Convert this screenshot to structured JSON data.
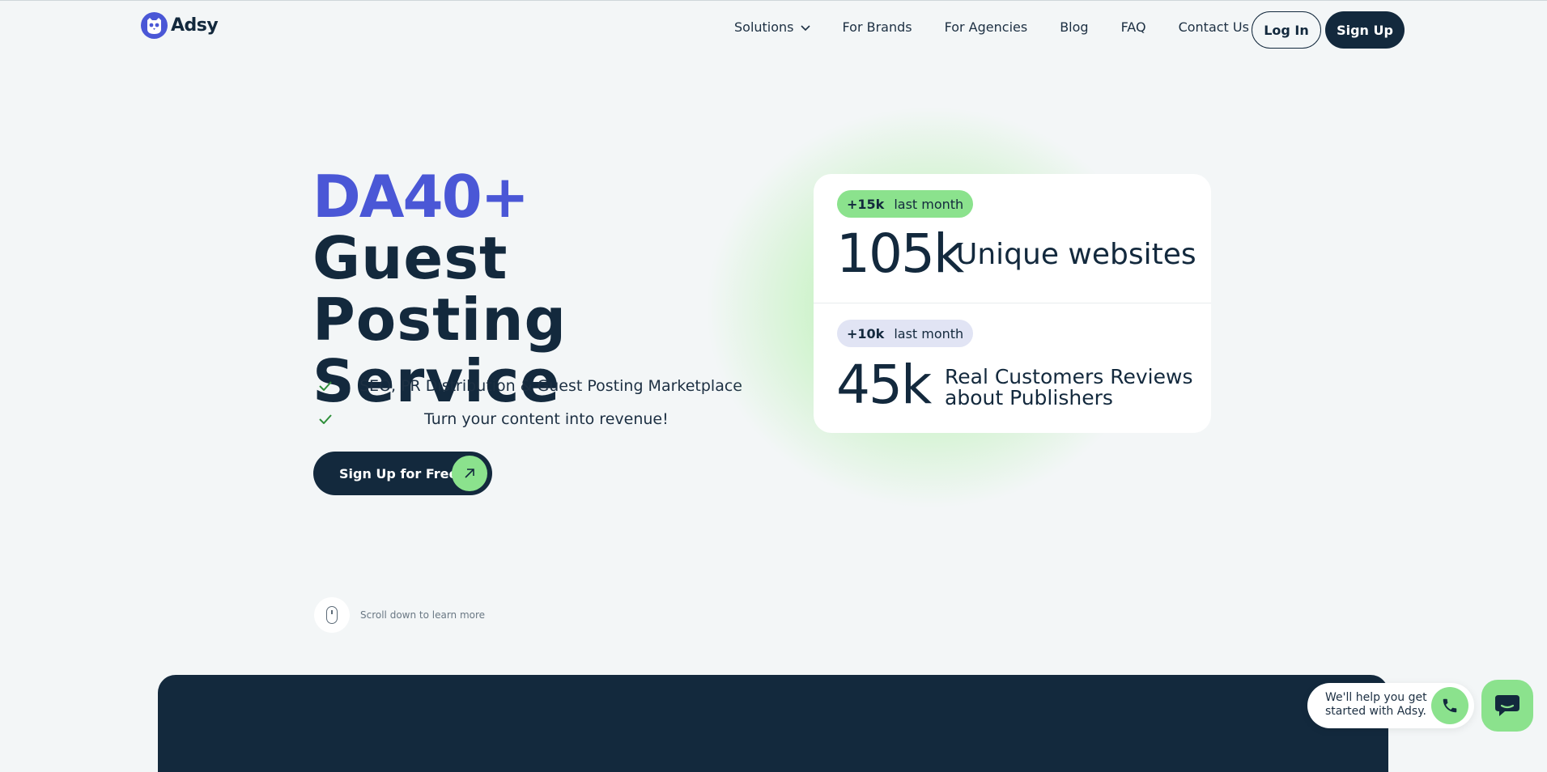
{
  "brand": {
    "name": "Adsy",
    "accent_color": "#4a57d6",
    "dark_color": "#13293d",
    "green_color": "#8be28d"
  },
  "nav": {
    "items": [
      {
        "label": "Solutions",
        "has_dropdown": true
      },
      {
        "label": "For Brands"
      },
      {
        "label": "For Agencies"
      },
      {
        "label": "Blog"
      },
      {
        "label": "FAQ"
      },
      {
        "label": "Contact Us"
      }
    ],
    "login_label": "Log In",
    "signup_label": "Sign Up"
  },
  "hero": {
    "title_accent": "DA40+",
    "title_rest": " Guest Posting Service",
    "features": [
      "SEO, PR Distribution & Guest Posting Marketplace",
      "Turn your content into revenue!"
    ],
    "cta_label": "Sign Up for Free",
    "scroll_hint": "Scroll down to learn more"
  },
  "stats": [
    {
      "badge_value": "+15k",
      "badge_text": "last month",
      "value": "105k",
      "label": "Unique websites"
    },
    {
      "badge_value": "+10k",
      "badge_text": "last month",
      "value": "45k",
      "label": "Real Customers Reviews about Publishers"
    }
  ],
  "help": {
    "text": "We'll help you get started with Adsy."
  },
  "icons": [
    "logo-owl-icon",
    "chevron-down-icon",
    "check-icon",
    "arrow-up-right-icon",
    "mouse-icon",
    "phone-icon",
    "chat-icon"
  ]
}
